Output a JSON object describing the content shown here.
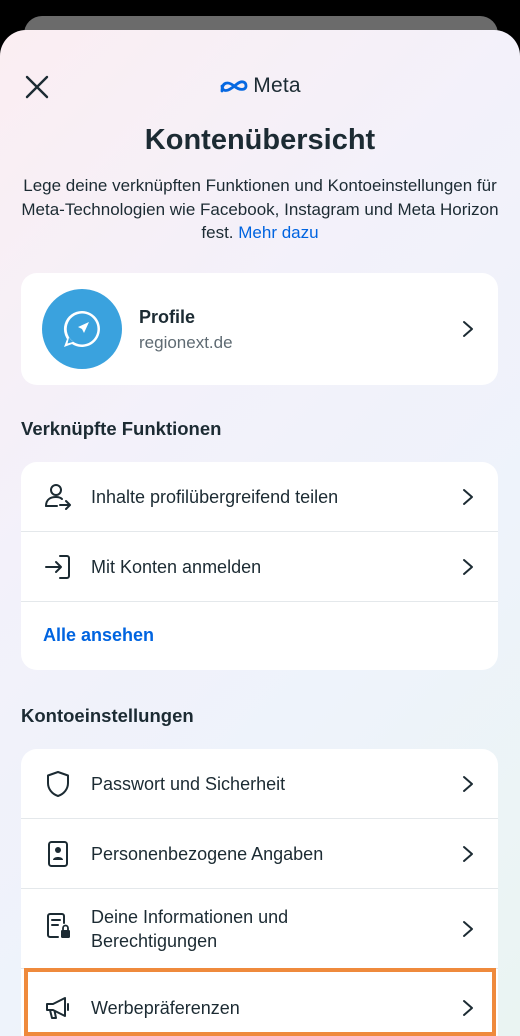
{
  "header": {
    "brand": "Meta",
    "title": "Kontenübersicht",
    "description": "Lege deine verknüpften Funktionen und Kontoeinstellungen für Meta-Technologien wie Facebook, Instagram und Meta Horizon fest.",
    "more_link": "Mehr dazu"
  },
  "profile": {
    "name": "Profile",
    "domain": "regionext.de"
  },
  "linked_features": {
    "heading": "Verknüpfte Funktionen",
    "items": [
      {
        "label": "Inhalte profilübergreifend teilen",
        "icon": "share-profile-icon"
      },
      {
        "label": "Mit Konten anmelden",
        "icon": "login-icon"
      }
    ],
    "see_all": "Alle ansehen"
  },
  "account_settings": {
    "heading": "Kontoeinstellungen",
    "items": [
      {
        "label": "Passwort und Sicherheit",
        "icon": "shield-icon"
      },
      {
        "label": "Personenbezogene Angaben",
        "icon": "id-card-icon"
      },
      {
        "label": "Deine Informationen und Berechtigungen",
        "icon": "document-lock-icon"
      },
      {
        "label": "Werbepräferenzen",
        "icon": "megaphone-icon"
      }
    ]
  },
  "colors": {
    "accent": "#0064e0",
    "avatar_bg": "#3aa2de",
    "highlight": "#ef8a3c"
  }
}
